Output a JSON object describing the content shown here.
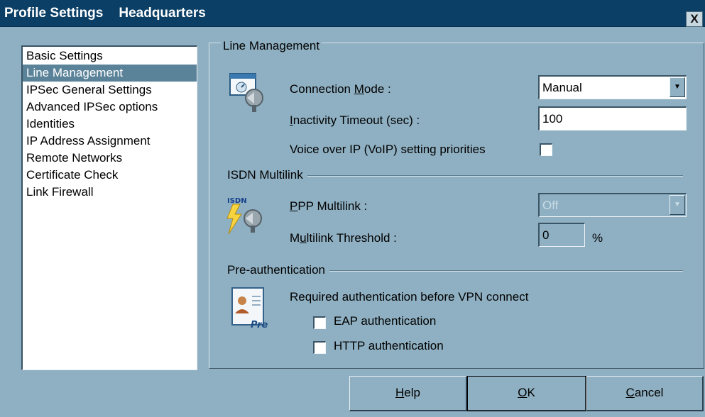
{
  "window": {
    "title": "Profile Settings",
    "subtitle": "Headquarters",
    "close_glyph": "X"
  },
  "nav": {
    "items": [
      {
        "label": "Basic Settings",
        "selected": false
      },
      {
        "label": "Line Management",
        "selected": true
      },
      {
        "label": "IPSec General Settings",
        "selected": false
      },
      {
        "label": "Advanced IPSec options",
        "selected": false
      },
      {
        "label": "Identities",
        "selected": false
      },
      {
        "label": "IP Address Assignment",
        "selected": false
      },
      {
        "label": "Remote Networks",
        "selected": false
      },
      {
        "label": "Certificate Check",
        "selected": false
      },
      {
        "label": "Link Firewall",
        "selected": false
      }
    ]
  },
  "panel": {
    "title": "Line Management",
    "connection_mode": {
      "label_pre": "Connection ",
      "label_key": "M",
      "label_post": "ode :",
      "value": "Manual"
    },
    "inactivity_timeout": {
      "label_key": "I",
      "label_post": "nactivity Timeout (sec) :",
      "value": "100"
    },
    "voip": {
      "label": "Voice over IP (VoIP) setting priorities",
      "checked": false
    }
  },
  "isdn": {
    "title": "ISDN Multilink",
    "icon_text": "ISDN",
    "ppp_multilink": {
      "label_key": "P",
      "label_post": "PP Multilink :",
      "value": "Off",
      "enabled": false
    },
    "multilink_threshold": {
      "label_pre": "M",
      "label_key": "u",
      "label_post": "ltilink Threshold :",
      "value": "0",
      "unit": "%",
      "enabled": false
    }
  },
  "preauth": {
    "title": "Pre-authentication",
    "icon_text": "Pre",
    "description": "Required authentication before VPN connect",
    "eap": {
      "label": "EAP authentication",
      "checked": false
    },
    "http": {
      "label": "HTTP authentication",
      "checked": false
    }
  },
  "buttons": {
    "help": {
      "key": "H",
      "rest": "elp"
    },
    "ok": {
      "key": "O",
      "rest": "K"
    },
    "cancel": {
      "key": "C",
      "rest": "ancel"
    }
  },
  "colors": {
    "title_bar": "#0b3f66",
    "dialog_bg": "#8fb0c2",
    "selection": "#5a8298"
  },
  "icons": [
    "line-connection-icon",
    "isdn-multilink-icon",
    "pre-authentication-icon",
    "dropdown-arrow-icon",
    "close-icon"
  ]
}
